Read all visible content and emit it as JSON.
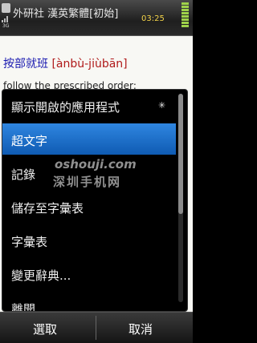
{
  "status": {
    "title": "外研社 漢英繁體[初始]",
    "time": "03:25",
    "network": "3G"
  },
  "page": {
    "headword": "按部就班",
    "pinyin": "[ànbù-jiùbān]",
    "definition": "follow the prescribed order;"
  },
  "menu": {
    "items": [
      {
        "label": "顯示開啟的應用程式",
        "icon": "multitask-icon"
      },
      {
        "label": "超文字",
        "selected": true
      },
      {
        "label": "記錄"
      },
      {
        "label": "儲存至字彙表"
      },
      {
        "label": "字彙表"
      },
      {
        "label": "變更辭典..."
      },
      {
        "label": "離開"
      }
    ]
  },
  "softkeys": {
    "left": "選取",
    "right": "取消"
  },
  "watermark": {
    "line1": "oshouji.com",
    "line2": "深圳手机网"
  }
}
